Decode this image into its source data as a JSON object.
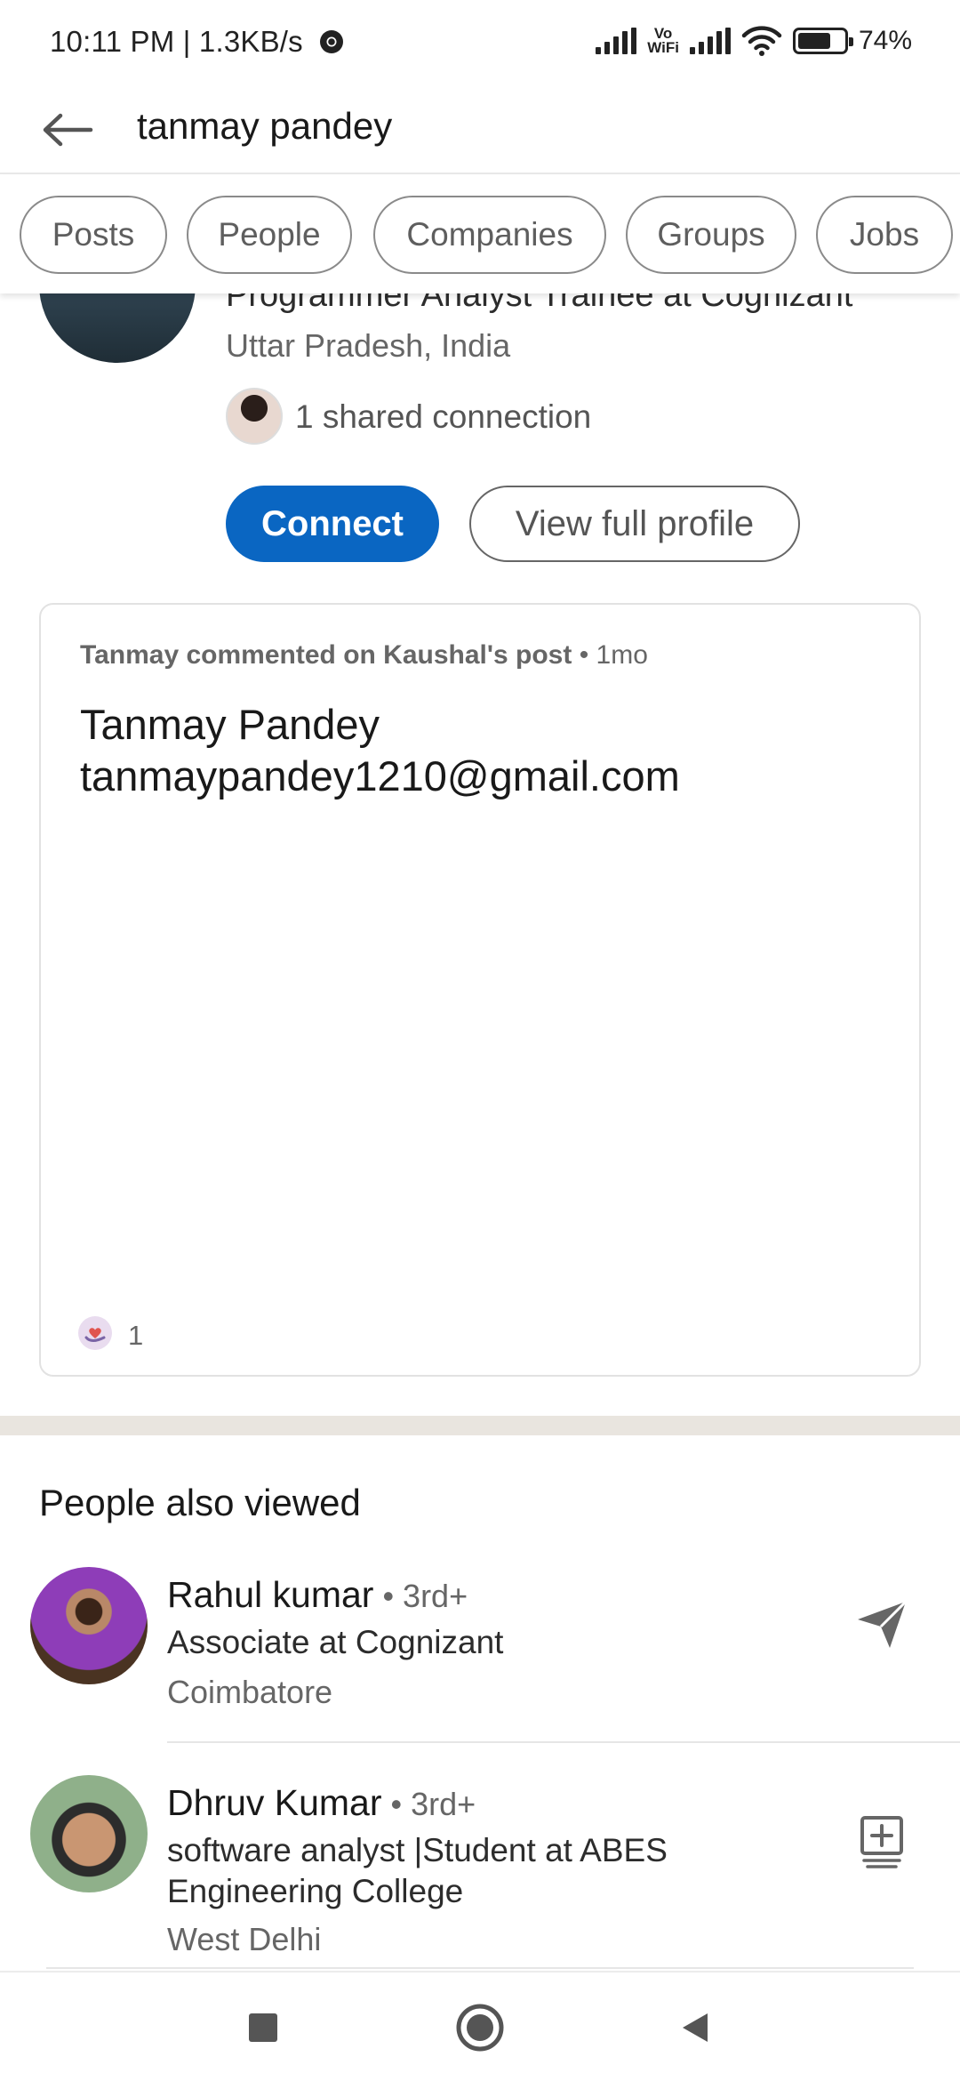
{
  "status_bar": {
    "time": "10:11 PM | 1.3KB/s",
    "vowifi_top": "Vo",
    "vowifi_bottom": "WiFi",
    "battery": "74%"
  },
  "search": {
    "query": "tanmay pandey"
  },
  "filters": [
    "Posts",
    "People",
    "Companies",
    "Groups",
    "Jobs"
  ],
  "result": {
    "headline": "Programmer Analyst Trainee at Cognizant",
    "location": "Uttar Pradesh, India",
    "shared_connections": "1 shared connection",
    "connect_label": "Connect",
    "view_profile_label": "View full profile"
  },
  "activity": {
    "actor_text": "Tanmay commented on Kaushal's post",
    "time_suffix": " • 1mo",
    "body_line1": "Tanmay Pandey",
    "body_line2": "tanmaypandey1210@gmail.com",
    "reaction_count": "1"
  },
  "people_also_viewed": {
    "title": "People also viewed",
    "people": [
      {
        "name": "Rahul kumar",
        "degree": " • 3rd+",
        "headline": "Associate at Cognizant",
        "location": "Coimbatore",
        "action_icon": "send-icon"
      },
      {
        "name": "Dhruv Kumar",
        "degree": " • 3rd+",
        "headline": "software analyst |Student at ABES Engineering College",
        "location": "West Delhi",
        "action_icon": "add-connection-icon"
      }
    ]
  },
  "colors": {
    "primary": "#0a66c2",
    "divider": "#e9e5df"
  }
}
